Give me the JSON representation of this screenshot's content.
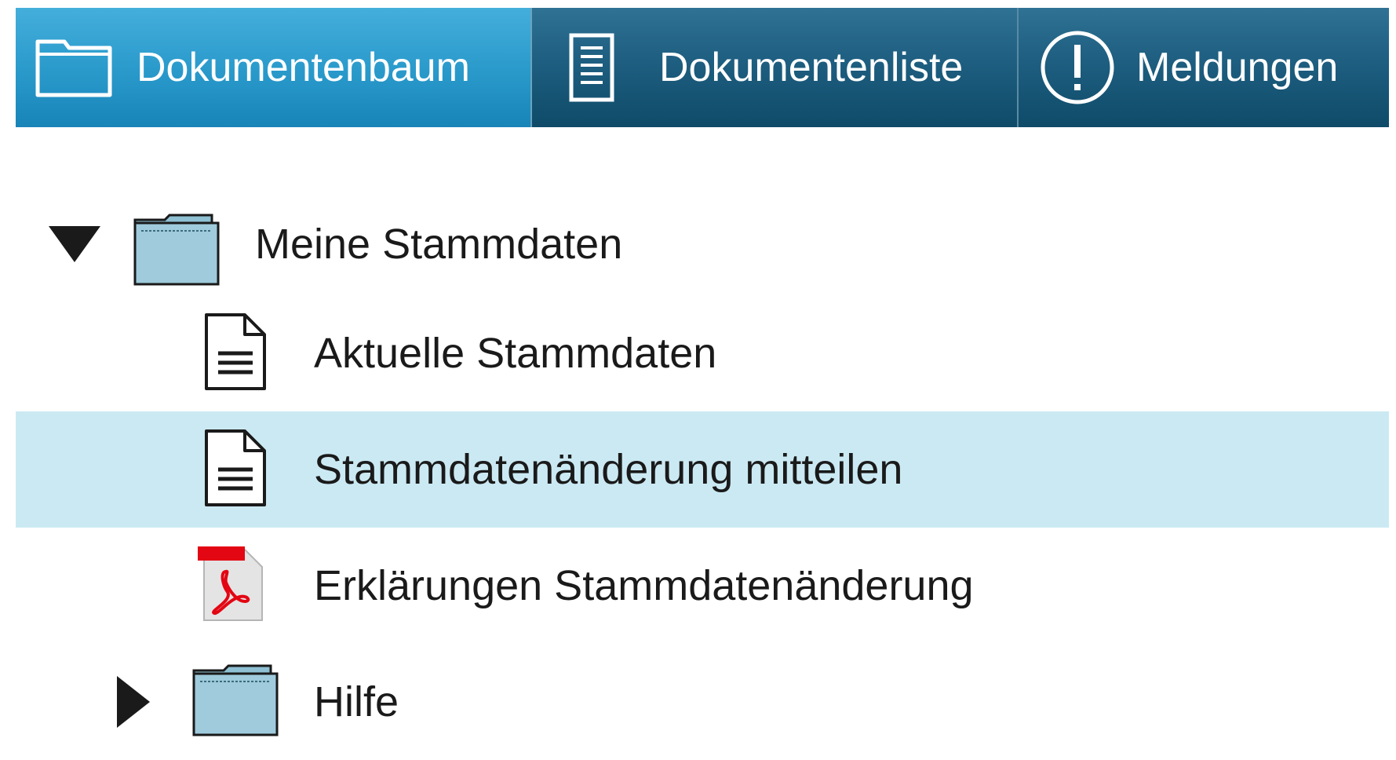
{
  "tabs": [
    {
      "label": "Dokumentenbaum",
      "icon": "folder-icon",
      "active": true
    },
    {
      "label": "Dokumentenliste",
      "icon": "document-list-icon",
      "active": false
    },
    {
      "label": "Meldungen",
      "icon": "exclamation-icon",
      "active": false
    }
  ],
  "tree": {
    "items": [
      {
        "label": "Meine Stammdaten",
        "type": "folder",
        "expanded": true
      },
      {
        "label": "Aktuelle Stammdaten",
        "type": "document"
      },
      {
        "label": "Stammdatenänderung mitteilen",
        "type": "document",
        "selected": true
      },
      {
        "label": "Erklärungen Stammdatenänderung",
        "type": "pdf"
      },
      {
        "label": "Hilfe",
        "type": "folder",
        "expanded": false
      }
    ]
  },
  "colors": {
    "tab_active": "#2b9bcc",
    "tab_inactive": "#1e5e80",
    "selected_row": "#cbe9f3",
    "folder_fill": "#8fc0d3",
    "pdf_red": "#e30613"
  }
}
